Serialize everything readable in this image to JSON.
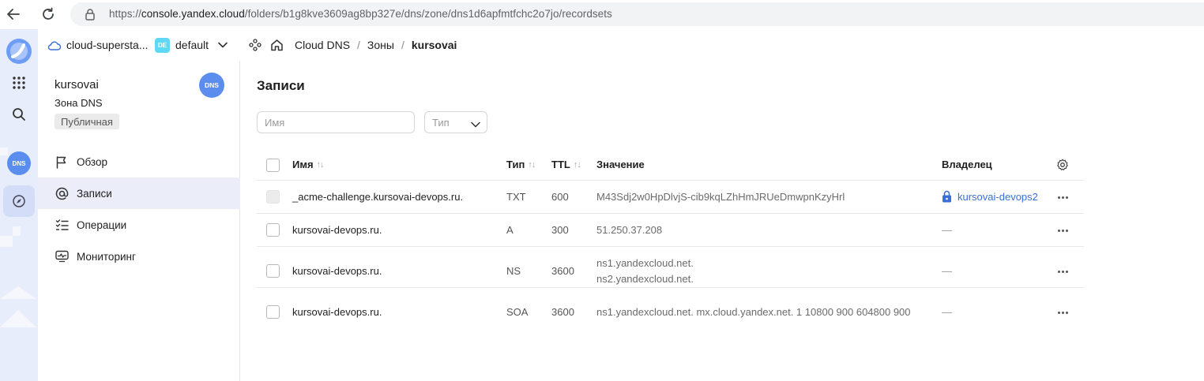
{
  "browser": {
    "url_prefix": "https://",
    "url_host": "console.yandex.cloud",
    "url_path": "/folders/b1g8kve3609ag8bp327e/dns/zone/dns1d6apfmtfchc2o7jo/recordsets"
  },
  "topbar": {
    "cloud_name": "cloud-supersta...",
    "env_badge": "DE",
    "folder_name": "default",
    "breadcrumbs": [
      "Cloud DNS",
      "Зоны",
      "kursovai"
    ],
    "separator": "/"
  },
  "rail": {
    "service_badge": "DNS"
  },
  "sidebar": {
    "title": "kursovai",
    "subtitle": "Зона DNS",
    "tag": "Публичная",
    "logo_text": "DNS",
    "items": [
      {
        "label": "Обзор",
        "icon": "flag-icon"
      },
      {
        "label": "Записи",
        "icon": "at-icon"
      },
      {
        "label": "Операции",
        "icon": "list-check-icon"
      },
      {
        "label": "Мониторинг",
        "icon": "monitor-icon"
      }
    ]
  },
  "main": {
    "title": "Записи",
    "name_placeholder": "Имя",
    "type_placeholder": "Тип",
    "columns": {
      "name": "Имя",
      "type": "Тип",
      "ttl": "TTL",
      "value": "Значение",
      "owner": "Владелец"
    },
    "rows": [
      {
        "name": "_acme-challenge.kursovai-devops.ru.",
        "type": "TXT",
        "ttl": "600",
        "value_1": "M43Sdj2w0HpDlvjS-cib9kqLZhHmJRUeDmwpnKzyHrl",
        "value_2": "",
        "owner": "kursovai-devops2"
      },
      {
        "name": "kursovai-devops.ru.",
        "type": "A",
        "ttl": "300",
        "value_1": "51.250.37.208",
        "value_2": "",
        "owner": "—"
      },
      {
        "name": "kursovai-devops.ru.",
        "type": "NS",
        "ttl": "3600",
        "value_1": "ns1.yandexcloud.net.",
        "value_2": "ns2.yandexcloud.net.",
        "owner": "—"
      },
      {
        "name": "kursovai-devops.ru.",
        "type": "SOA",
        "ttl": "3600",
        "value_1": "ns1.yandexcloud.net. mx.cloud.yandex.net. 1 10800 900 604800 900",
        "value_2": "",
        "owner": "—"
      }
    ]
  },
  "colors": {
    "accent": "#3a6fd8",
    "rail_bg": "#e8edfb",
    "active_item_bg": "#ebeef9",
    "dns_logo": "#5b8def"
  }
}
